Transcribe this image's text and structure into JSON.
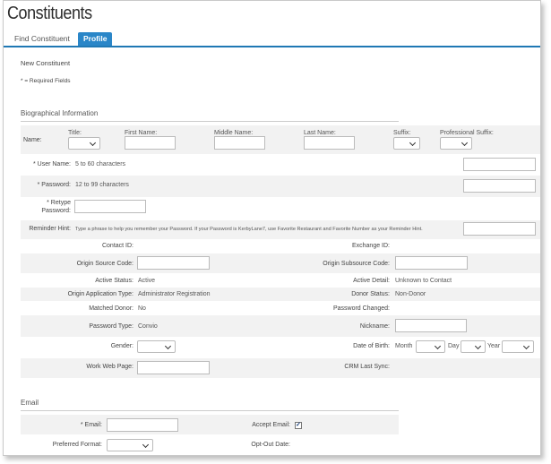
{
  "page": {
    "title": "Constituents"
  },
  "tabs": [
    {
      "label": "Find Constituent"
    },
    {
      "label": "Profile"
    }
  ],
  "intro": {
    "new_constituent": "New Constituent",
    "required_note": "* = Required Fields"
  },
  "bio": {
    "heading": "Biographical Information",
    "name_label": "Name:",
    "title_label": "Title:",
    "first_label": "First Name:",
    "middle_label": "Middle Name:",
    "last_label": "Last Name:",
    "suffix_label": "Suffix:",
    "prof_suffix_label": "Professional Suffix:",
    "username_label": "* User Name:",
    "username_hint": "5 to 60 characters",
    "password_label": "* Password:",
    "password_hint": "12 to 99 characters",
    "retype_label_1": "* Retype",
    "retype_label_2": "Password:",
    "reminder_label": "Reminder Hint:",
    "reminder_hint": "Type a phrase to help you remember your Password. If your Password is KerbyLane7, use Favorite Restaurant and Favorite Number as your Reminder Hint.",
    "contact_id_label": "Contact ID:",
    "exchange_id_label": "Exchange ID:",
    "origin_source_label": "Origin Source Code:",
    "origin_subsource_label": "Origin Subsource Code:",
    "active_status_label": "Active Status:",
    "active_status_value": "Active",
    "active_detail_label": "Active Detail:",
    "active_detail_value": "Unknown to Contact",
    "origin_app_label": "Origin Application Type:",
    "origin_app_value": "Administrator Registration",
    "donor_status_label": "Donor Status:",
    "donor_status_value": "Non-Donor",
    "matched_donor_label": "Matched Donor:",
    "matched_donor_value": "No",
    "password_changed_label": "Password Changed:",
    "password_type_label": "Password Type:",
    "password_type_value": "Convio",
    "nickname_label": "Nickname:",
    "gender_label": "Gender:",
    "dob_label": "Date of Birth:",
    "month_label": "Month",
    "day_label": "Day",
    "year_label": "Year",
    "work_web_label": "Work Web Page:",
    "crm_sync_label": "CRM Last Sync:"
  },
  "email": {
    "heading": "Email",
    "email_label": "* Email:",
    "accept_label": "Accept Email:",
    "accept_checked": "✓",
    "format_label": "Preferred Format:",
    "optout_label": "Opt-Out Date:"
  }
}
